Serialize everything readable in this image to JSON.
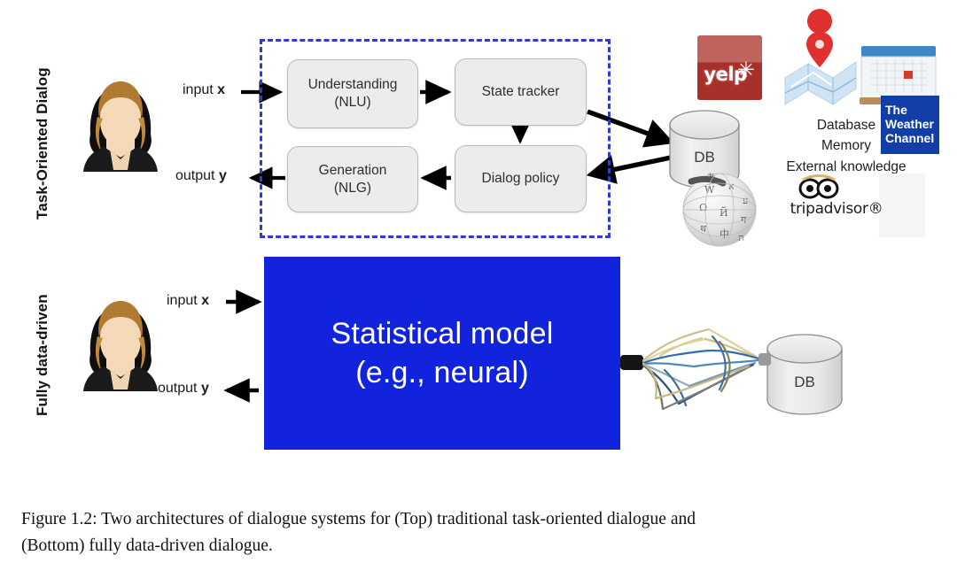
{
  "figure": {
    "caption_line1": "Figure 1.2:  Two architectures of dialogue systems for (Top) traditional task-oriented dialogue and",
    "caption_line2": "(Bottom) fully data-driven dialogue."
  },
  "rows": {
    "top": {
      "side_label": "Task-Oriented Dialog",
      "input_label_text": "input ",
      "input_label_var": "x",
      "output_label_text": "output ",
      "output_label_var": "y",
      "modules": [
        {
          "id": "nlu",
          "line1": "Understanding",
          "line2": "(NLU)"
        },
        {
          "id": "state-tracker",
          "line1": "State tracker",
          "line2": ""
        },
        {
          "id": "dialog-policy",
          "line1": "Dialog policy",
          "line2": ""
        },
        {
          "id": "nlg",
          "line1": "Generation",
          "line2": "(NLG)"
        }
      ],
      "db_label": "DB",
      "knowledge_lines": [
        "Database",
        "Memory",
        "External knowledge"
      ],
      "logos": [
        {
          "name": "yelp-logo",
          "label": "yelp"
        },
        {
          "name": "maps-logo",
          "label": ""
        },
        {
          "name": "calendar-logo",
          "label": ""
        },
        {
          "name": "weather-channel-logo",
          "line1": "The",
          "line2": "Weather",
          "line3": "Channel"
        },
        {
          "name": "wikipedia-logo",
          "label": ""
        },
        {
          "name": "tripadvisor-logo",
          "label": "tripadvisor"
        },
        {
          "name": "foursquare-logo",
          "label": ""
        }
      ]
    },
    "bottom": {
      "side_label": "Fully data-driven",
      "input_label_text": "input ",
      "input_label_var": "x",
      "output_label_text": "output ",
      "output_label_var": "y",
      "model_line1": "Statistical model",
      "model_line2": "(e.g., neural)",
      "db_label": "DB"
    }
  },
  "colors": {
    "dashed_border": "#2f39d6",
    "model_blue": "#1223dd",
    "module_fill": "#ececed",
    "module_border": "#b9b9c6",
    "yelp_red": "#b0352c",
    "weather_blue": "#123ea8",
    "foursquare_pink": "#ef4c79",
    "arrow_black": "#000000",
    "background": "#ffffff"
  }
}
